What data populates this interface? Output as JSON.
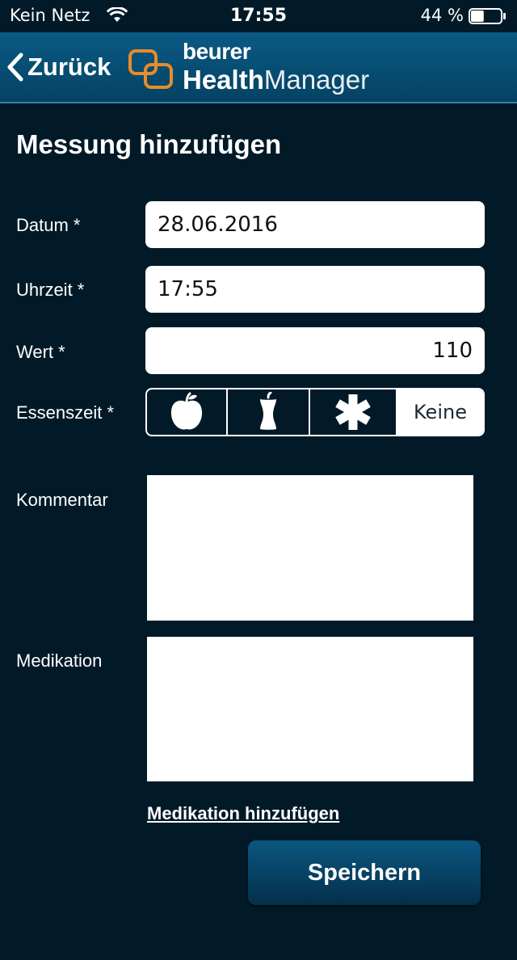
{
  "status_bar": {
    "carrier": "Kein Netz",
    "time": "17:55",
    "battery": "44 %",
    "battery_level": 0.44
  },
  "nav": {
    "back_label": "Zurück",
    "brand": "beurer",
    "product_bold": "Health",
    "product_rest": "Manager"
  },
  "page": {
    "title": "Messung hinzufügen"
  },
  "form": {
    "date_label": "Datum *",
    "date_value": "28.06.2016",
    "time_label": "Uhrzeit *",
    "time_value": "17:55",
    "value_label": "Wert *",
    "value_value": "110",
    "meal_label": "Essenszeit *",
    "meal_options": [
      {
        "icon": "apple-icon"
      },
      {
        "icon": "apple-core-icon"
      },
      {
        "icon": "asterisk-icon"
      },
      {
        "label": "Keine",
        "selected": true
      }
    ],
    "comment_label": "Kommentar",
    "medication_label": "Medikation",
    "add_medication_link": "Medikation hinzufügen",
    "save_label": "Speichern"
  },
  "colors": {
    "background": "#021a28",
    "navbar": "#0a5a85",
    "logo_orange": "#e98b2a"
  }
}
